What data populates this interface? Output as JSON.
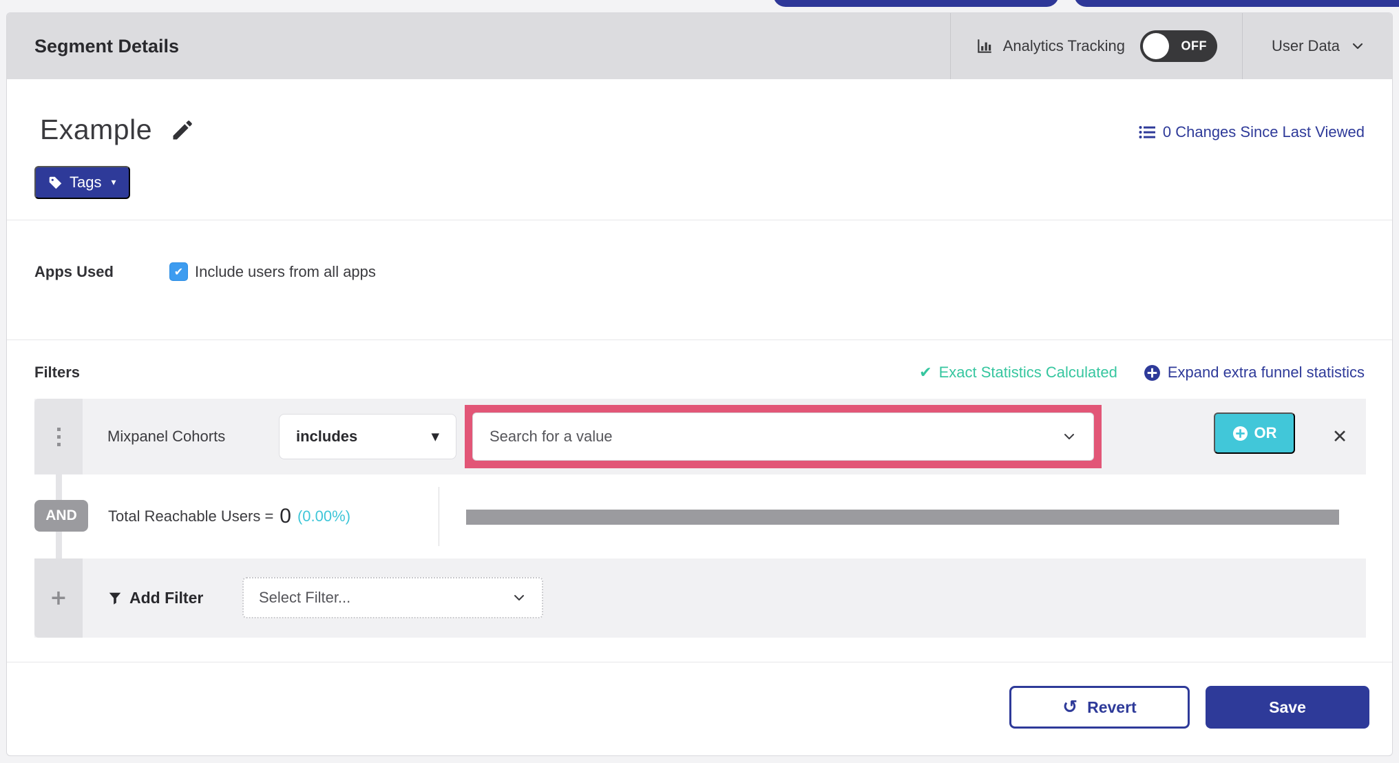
{
  "header": {
    "title": "Segment Details",
    "analytics_label": "Analytics Tracking",
    "toggle_state": "OFF",
    "user_data_label": "User Data"
  },
  "segment": {
    "name": "Example",
    "tags_button": "Tags",
    "changes_link": "0 Changes Since Last Viewed"
  },
  "apps_used": {
    "label": "Apps Used",
    "checkbox_label": "Include users from all apps",
    "checked": true
  },
  "filters": {
    "heading": "Filters",
    "exact_statistics": "Exact Statistics Calculated",
    "expand_link": "Expand extra funnel statistics",
    "filter_row": {
      "field": "Mixpanel Cohorts",
      "operator": "includes",
      "value_placeholder": "Search for a value",
      "or_button": "OR"
    },
    "conjunction": "AND",
    "reachable_label": "Total Reachable Users =",
    "reachable_value": "0",
    "reachable_percent": "(0.00%)",
    "add_filter_label": "Add Filter",
    "select_filter_placeholder": "Select Filter..."
  },
  "footer": {
    "revert": "Revert",
    "save": "Save"
  },
  "icons": {
    "check": "✔",
    "close": "✕",
    "revert": "↺",
    "plus": "+",
    "dropdown_triangle": "▼",
    "tags_caret": "▾"
  },
  "colors": {
    "indigo": "#2e3a99",
    "teal_green": "#36c69f",
    "cyan": "#3fc6d8",
    "highlight_pink": "#e25677",
    "toggle_dark": "#38383a",
    "checkbox_blue": "#3d9cf0",
    "bar_gray": "#9b9b9f"
  }
}
